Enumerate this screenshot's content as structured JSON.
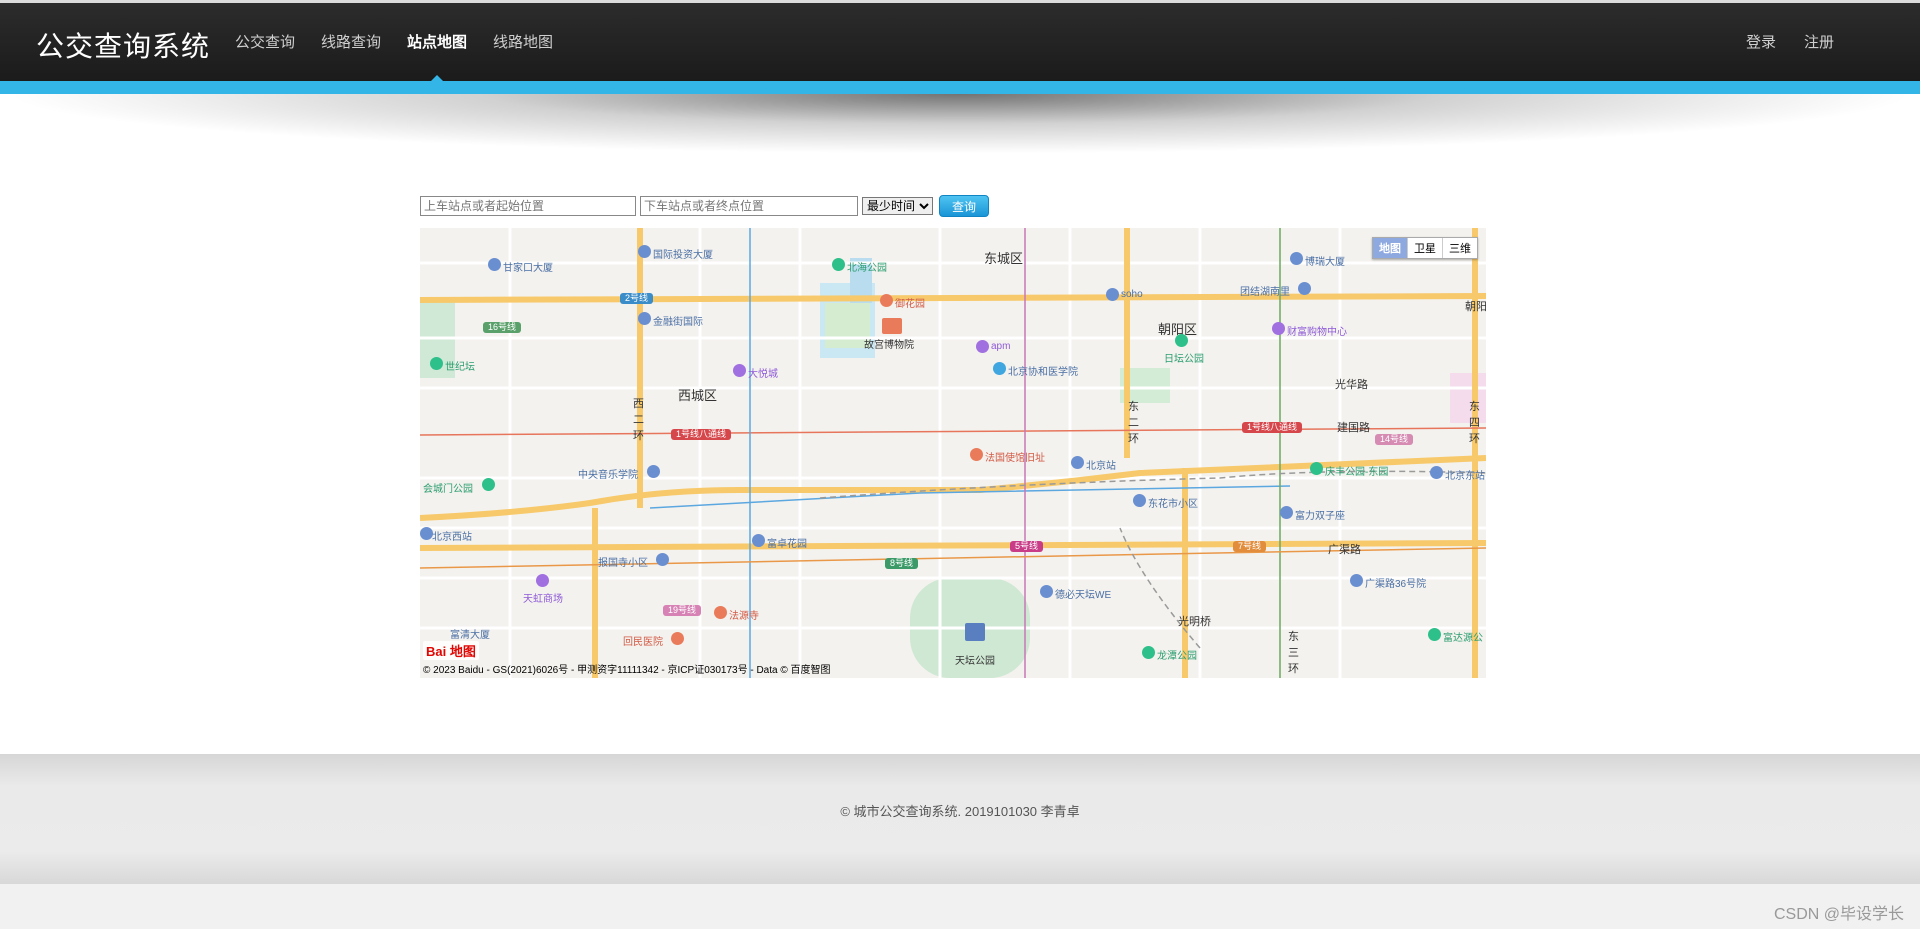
{
  "header": {
    "brand": "公交查询系统",
    "nav": [
      "公交查询",
      "线路查询",
      "站点地图",
      "线路地图"
    ],
    "active_nav": "站点地图",
    "login": "登录",
    "register": "注册",
    "accent_color": "#33b5e8"
  },
  "search": {
    "start_placeholder": "上车站点或者起始位置",
    "end_placeholder": "下车站点或者终点位置",
    "mode_selected": "最少时间",
    "query_label": "查询"
  },
  "map": {
    "type_buttons": [
      "地图",
      "卫星",
      "三维"
    ],
    "type_selected": "地图",
    "logo": "Bai 地图",
    "copyright": "© 2023 Baidu - GS(2021)6026号 - 甲测资字11111342 - 京ICP证030173号 - Data © 百度智图",
    "districts": [
      "东城区",
      "西城区",
      "朝阳区"
    ],
    "roads": [
      "建国路",
      "广渠路",
      "光华路",
      "光明桥",
      "西二环",
      "东二环",
      "东三环",
      "东四环",
      "朝阳"
    ],
    "pois": {
      "ganjiakou": "甘家口大厦",
      "guoji": "国际投资大厦",
      "beihai": "北海公园",
      "yuhuayuan": "御花园",
      "gugong": "故宫博物院",
      "jinrongjie": "金融街国际",
      "shijiyuan": "世纪坛",
      "dayuecheng": "大悦城",
      "apm": "apm",
      "xiehe": "北京协和医学院",
      "soho": "soho",
      "tuanjiehu": "团结湖南里",
      "boruida": "博瑞大厦",
      "caifu": "财富购物中心",
      "ritan": "日坛公园",
      "zhongyang": "中央音乐学院",
      "huichengmen": "会城门公园",
      "fagu": "法国使馆旧址",
      "bjzhan": "北京站",
      "dongbianmen": "东花市小区",
      "qingfeng": "庆丰公园-东园",
      "bjdong": "北京东站",
      "fuli": "富力双子座",
      "bjxi": "北京西站",
      "baoguosi": "报国寺小区",
      "fuzhuo": "富卓花园",
      "tianhong": "天虹商场",
      "fayuansi": "法源寺",
      "huimin": "回民医院",
      "tiantan": "天坛公园",
      "tianhe": "德必天坛WE",
      "longtan": "龙潭公园",
      "guangqu36": "广渠路36号院",
      "fuhe": "富清大厦",
      "sdmx": "富达源公"
    },
    "lines": {
      "l2": "2号线",
      "l16": "16号线",
      "l1_west": "1号线八通线",
      "l1_east": "1号线八通线",
      "l14": "14号线",
      "l5": "5号线",
      "l7": "7号线",
      "l8": "8号线",
      "l19": "19号线"
    }
  },
  "footer": {
    "text": "© 城市公交查询系统. 2019101030 李青卓"
  },
  "watermark": "CSDN @毕设学长"
}
